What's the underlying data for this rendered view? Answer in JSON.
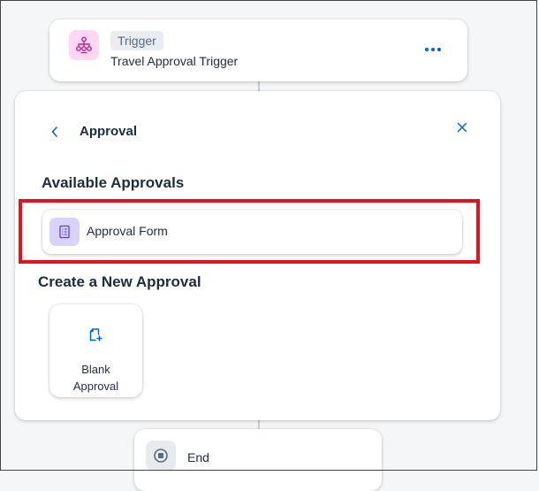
{
  "trigger": {
    "icon": "workflow-trigger-icon",
    "tag": "Trigger",
    "name": "Travel Approval Trigger",
    "more_icon": "more-options-icon"
  },
  "panel": {
    "back_icon": "chevron-left-icon",
    "title": "Approval",
    "close_icon": "close-icon",
    "available_title": "Available Approvals",
    "available_items": [
      {
        "icon": "form-icon",
        "label": "Approval Form"
      }
    ],
    "create_title": "Create a New Approval",
    "create_items": [
      {
        "icon": "add-document-icon",
        "line1": "Blank",
        "line2": "Approval"
      }
    ]
  },
  "end": {
    "icon": "stop-icon",
    "label": "End"
  },
  "colors": {
    "accent": "#0064d9",
    "highlight": "#e1141e",
    "trigger_icon_bg": "#ffd6f3",
    "form_icon_bg": "#d9d3fb"
  }
}
